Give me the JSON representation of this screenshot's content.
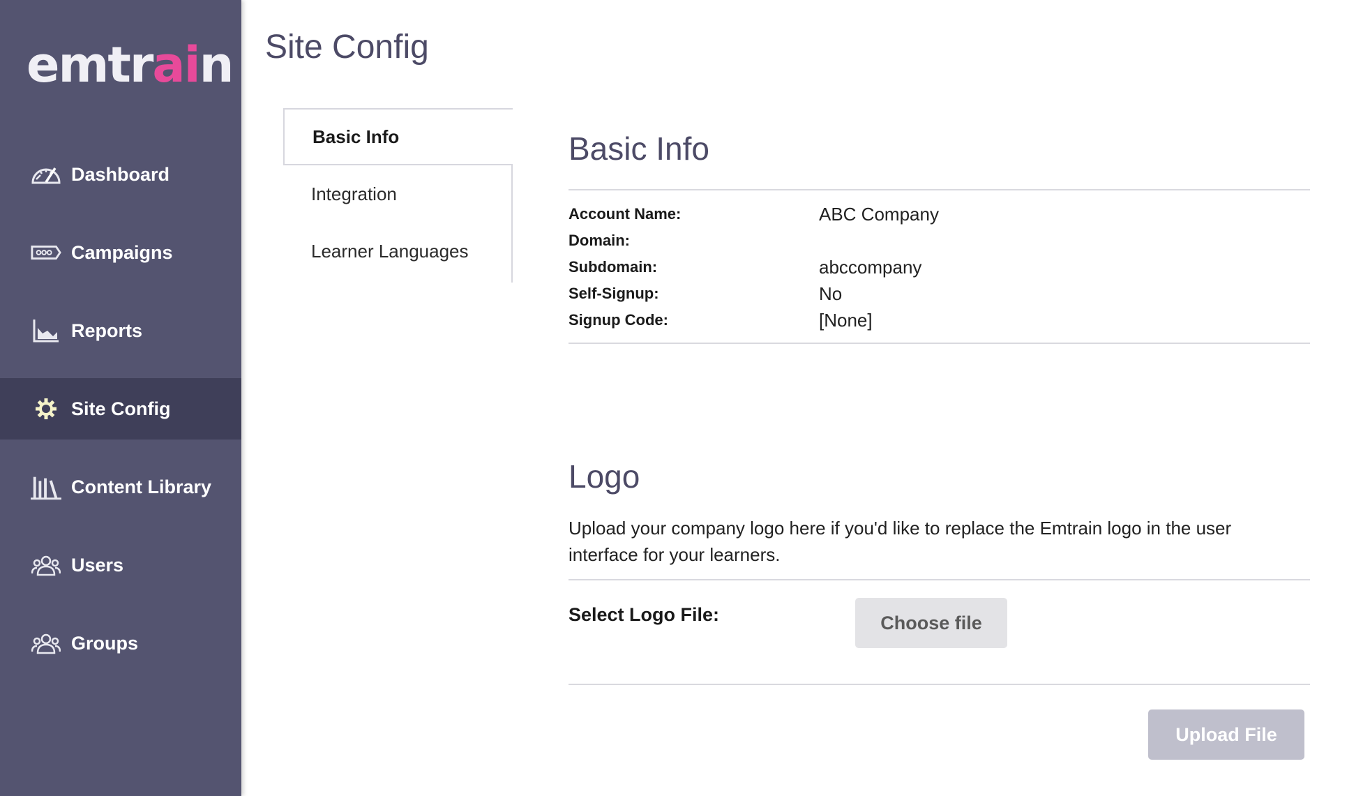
{
  "brand": {
    "logo_prefix": "emtr",
    "logo_accent": "ai",
    "logo_suffix": "n"
  },
  "colors": {
    "sidebar": "#545470",
    "sidebar_active": "#3f3f59",
    "accent": "#e84a9a",
    "title": "#4c4a66"
  },
  "sidebar": {
    "items": [
      {
        "label": "Dashboard",
        "icon": "dashboard-gauge-icon"
      },
      {
        "label": "Campaigns",
        "icon": "campaigns-ticket-icon"
      },
      {
        "label": "Reports",
        "icon": "reports-chart-icon"
      },
      {
        "label": "Site Config",
        "icon": "gear-icon",
        "active": true
      },
      {
        "label": "Content Library",
        "icon": "books-icon"
      },
      {
        "label": "Users",
        "icon": "users-icon"
      },
      {
        "label": "Groups",
        "icon": "groups-icon"
      }
    ]
  },
  "page": {
    "title": "Site Config"
  },
  "tabs": [
    {
      "label": "Basic Info",
      "active": true
    },
    {
      "label": "Integration"
    },
    {
      "label": "Learner Languages"
    }
  ],
  "basic_info": {
    "title": "Basic Info",
    "rows": [
      {
        "label": "Account Name:",
        "value": "ABC Company"
      },
      {
        "label": "Domain:",
        "value": ""
      },
      {
        "label": "Subdomain:",
        "value": "abccompany"
      },
      {
        "label": "Self-Signup:",
        "value": "No"
      },
      {
        "label": "Signup Code:",
        "value": "[None]"
      }
    ]
  },
  "logo_section": {
    "title": "Logo",
    "description": "Upload your company logo here if you'd like to replace the Emtrain logo in the user interface for your learners.",
    "select_label": "Select Logo File:",
    "choose_button": "Choose file",
    "upload_button": "Upload File"
  }
}
